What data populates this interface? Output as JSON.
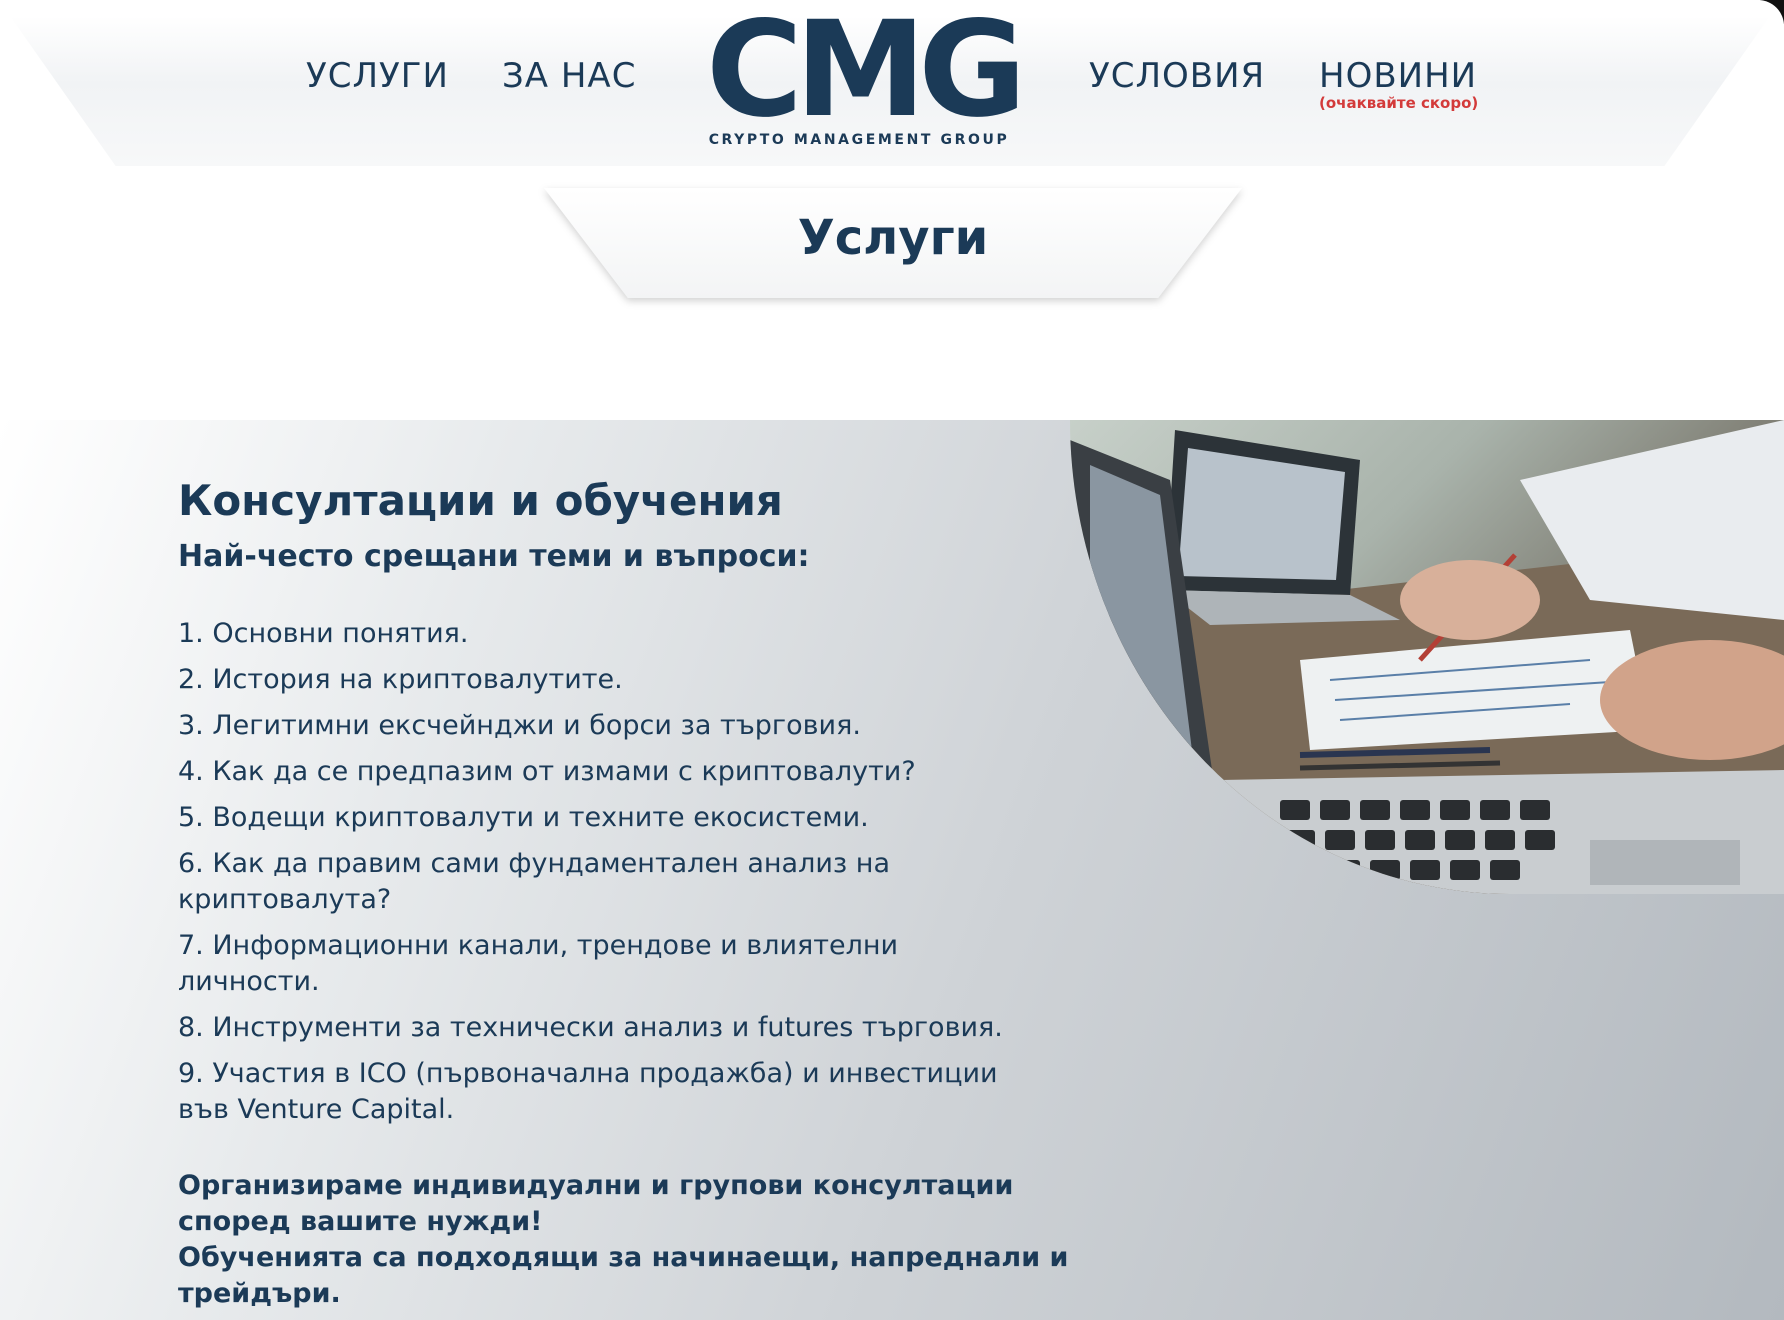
{
  "nav": {
    "left": [
      "УСЛУГИ",
      "ЗА НАС"
    ],
    "right": [
      "УСЛОВИЯ",
      "НОВИНИ"
    ],
    "news_note": "(очаквайте скоро)"
  },
  "logo": {
    "mark": "CMG",
    "text": "CRYPTO MANAGEMENT GROUP"
  },
  "page": {
    "title": "Услуги"
  },
  "section": {
    "heading": "Консултации и обучения",
    "subheading": "Най-често срещани теми и въпроси:",
    "topics": [
      "1. Основни понятия.",
      "2. История на криптовалутите.",
      "3. Легитимни ексчейнджи и борси за търговия.",
      "4. Как да се предпазим от измами с криптовалути?",
      "5. Водещи криптовалути и техните екосистеми.",
      "6. Как да правим сами фундаментален анализ на криптовалута?",
      "7. Информационни канали, трендове и влиятелни личности.",
      "8. Инструменти за технически анализ и futures търговия.",
      "9. Участия в ICO (първоначална продажба) и инвестиции във Venture Capital."
    ],
    "note_line1": "Организираме индивидуални и групови консултации според вашите нужди!",
    "note_line2": "Обученията са подходящи за начинаещи, напреднали и трейдъри."
  },
  "colors": {
    "brand": "#1b3a57",
    "accent_red": "#d33a3a"
  }
}
